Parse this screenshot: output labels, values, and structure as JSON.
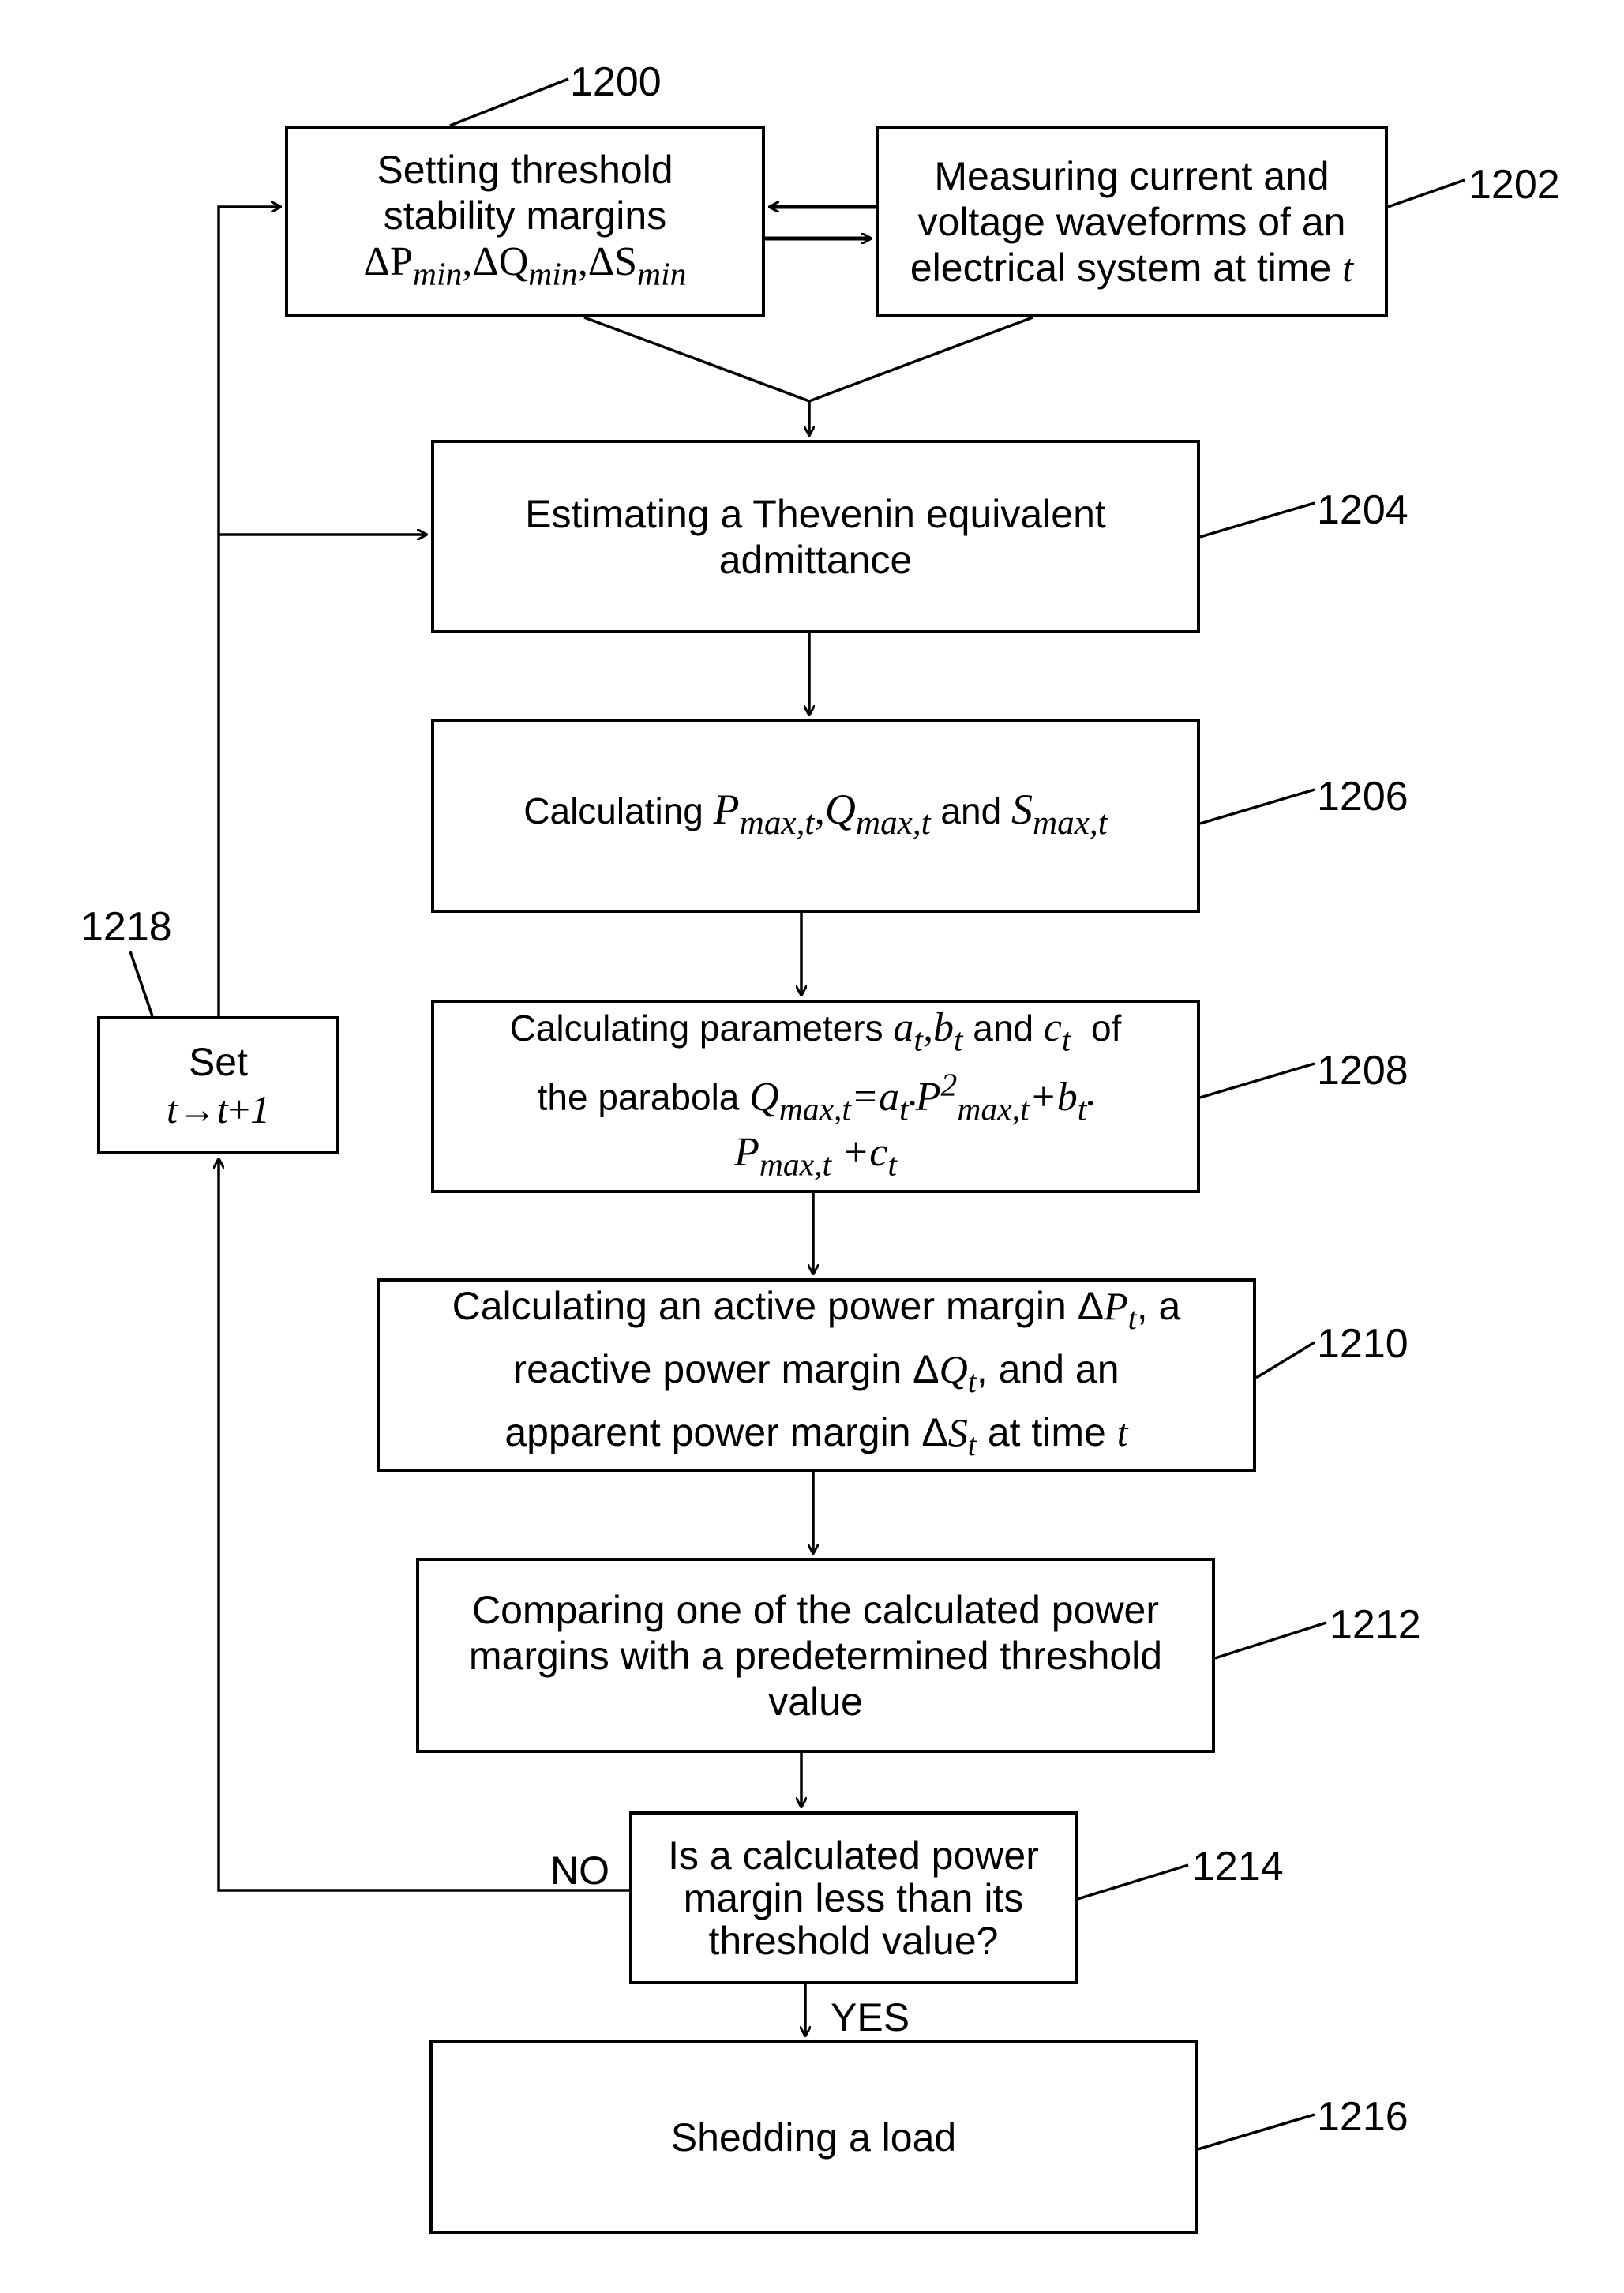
{
  "figure": {
    "steps": [
      {
        "id": "1200",
        "ref": "1200",
        "line1": "Setting threshold",
        "line2": "stability margins",
        "math": "ΔPmin,ΔQmin,ΔSmin",
        "math_parts": [
          "ΔP",
          "min",
          ",ΔQ",
          "min",
          ",ΔS",
          "min"
        ]
      },
      {
        "id": "1202",
        "ref": "1202",
        "line1": "Measuring current and",
        "line2": "voltage waveforms of an",
        "line3": "electrical system at time",
        "var": "t"
      },
      {
        "id": "1204",
        "ref": "1204",
        "line1": "Estimating a Thevenin equivalent",
        "line2": "admittance"
      },
      {
        "id": "1206",
        "ref": "1206",
        "text": "Calculating",
        "p": "P",
        "q": "Q",
        "s": "S",
        "sub": "max,t",
        "and": "and"
      },
      {
        "id": "1208",
        "ref": "1208",
        "line1": "Calculating parameters",
        "a": "a",
        "b": "b",
        "c": "c",
        "t": "t",
        "and": "and",
        "of": "of",
        "line2": "the parabola",
        "formula_lhs": "Q",
        "sub": "max,t",
        "eq": "=",
        "dot": "•",
        "p": "P",
        "sq": "2",
        "plus": "+"
      },
      {
        "id": "1210",
        "ref": "1210",
        "line1a": "Calculating an active power margin Δ",
        "line1b": ", a",
        "line2a": "reactive power margin Δ",
        "line2b": ", and an",
        "line3a": "apparent power margin Δ",
        "line3b": " at time ",
        "P": "P",
        "Q": "Q",
        "S": "S",
        "t": "t"
      },
      {
        "id": "1212",
        "ref": "1212",
        "text": "Comparing one of the calculated power margins with a predetermined threshold value"
      },
      {
        "id": "1214",
        "ref": "1214",
        "text": "Is a calculated power margin less than its threshold value?"
      },
      {
        "id": "1216",
        "ref": "1216",
        "text": "Shedding a load"
      },
      {
        "id": "1218",
        "ref": "1218",
        "line1": "Set",
        "formula": "t→t+1",
        "t": "t",
        "arrow": "→",
        "plus": "+",
        "one": "1"
      }
    ],
    "labels": {
      "no": "NO",
      "yes": "YES"
    }
  }
}
